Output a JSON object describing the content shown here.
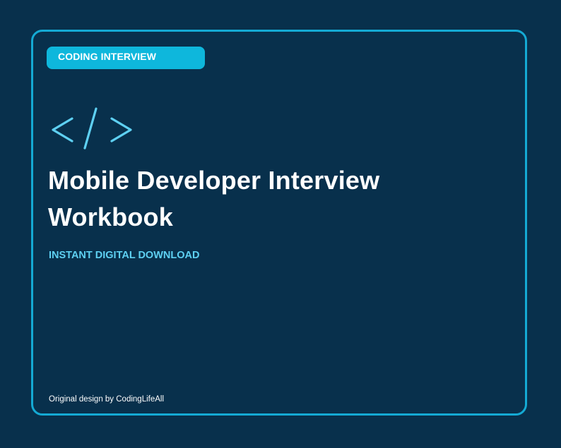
{
  "badge": {
    "label": "CODING INTERVIEW"
  },
  "icon": {
    "name": "code-brackets-icon",
    "color": "#5ed0f2"
  },
  "title": {
    "line1": "Mobile Developer Interview",
    "line2": "Workbook"
  },
  "subtitle": "INSTANT DIGITAL DOWNLOAD",
  "credit": "Original design by CodingLifeAll",
  "colors": {
    "background": "#08304c",
    "border": "#14aad4",
    "badge": "#0eb7dc",
    "accent": "#5ed0f2",
    "text": "#ffffff"
  }
}
